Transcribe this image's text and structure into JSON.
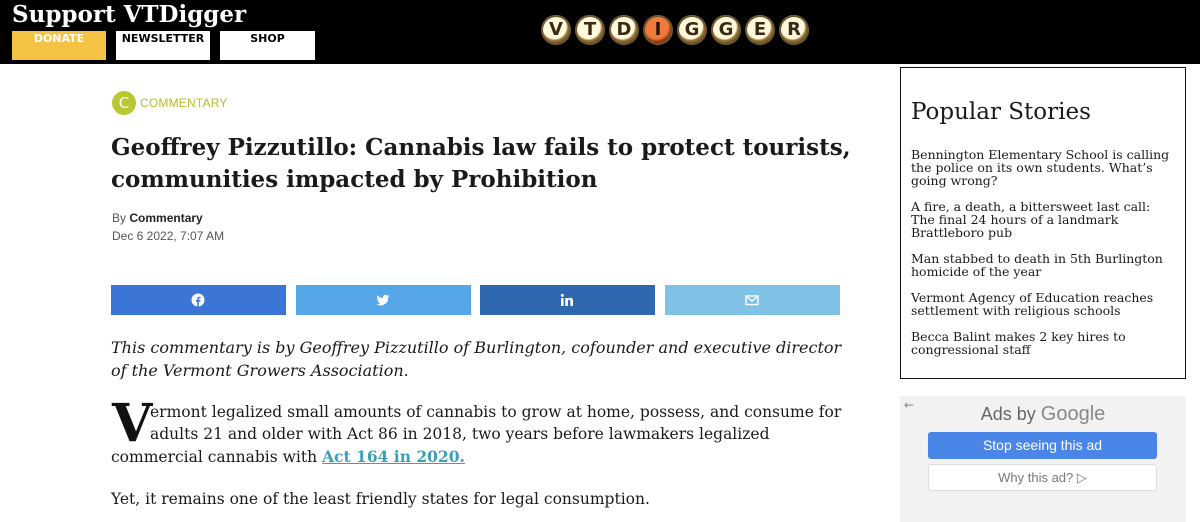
{
  "header": {
    "title": "Support VTDigger",
    "buttons": {
      "donate": "DONATE",
      "newsletter": "NEWSLETTER",
      "shop": "SHOP"
    },
    "logo_letters": [
      "V",
      "T",
      "D",
      "I",
      "G",
      "G",
      "E",
      "R"
    ],
    "donate_color": "#f5c344"
  },
  "article": {
    "category_badge": "C",
    "category": "COMMENTARY",
    "headline": "Geoffrey Pizzutillo: Cannabis law fails to protect tourists, communities impacted by Prohibition",
    "byline_prefix": "By",
    "author": "Commentary",
    "date": "Dec 6 2022, 7:07 AM",
    "share_icons": [
      "facebook-icon",
      "twitter-icon",
      "linkedin-icon",
      "email-icon"
    ],
    "intro": "This commentary is by Geoffrey Pizzutillo of Burlington, cofounder and executive director of the Vermont Growers Association.",
    "drop_cap": "V",
    "para1_first": "ermont legalized small amounts of cannabis to grow at home, possess, and consume for",
    "para1_rest": "adults 21 and older with Act 86 in 2018, two years before lawmakers legalized commercial cannabis with",
    "para1_link": "Act 164 in 2020.",
    "para2": "Yet, it remains one of the least friendly states for legal consumption."
  },
  "sidebar": {
    "popular_title": "Popular Stories",
    "stories": [
      "Bennington Elementary School is calling the police on its own students. What’s going wrong?",
      "A fire, a death, a bittersweet last call: The final 24 hours of a landmark Brattleboro pub",
      "Man stabbed to death in 5th Burlington homicide of the year",
      "Vermont Agency of Education reaches settlement with religious schools",
      "Becca Balint makes 2 key hires to congressional staff"
    ]
  },
  "ad": {
    "back_icon": "←",
    "ads_by": "Ads by",
    "google": "Google",
    "stop": "Stop seeing this ad",
    "why": "Why this ad? ▷"
  }
}
